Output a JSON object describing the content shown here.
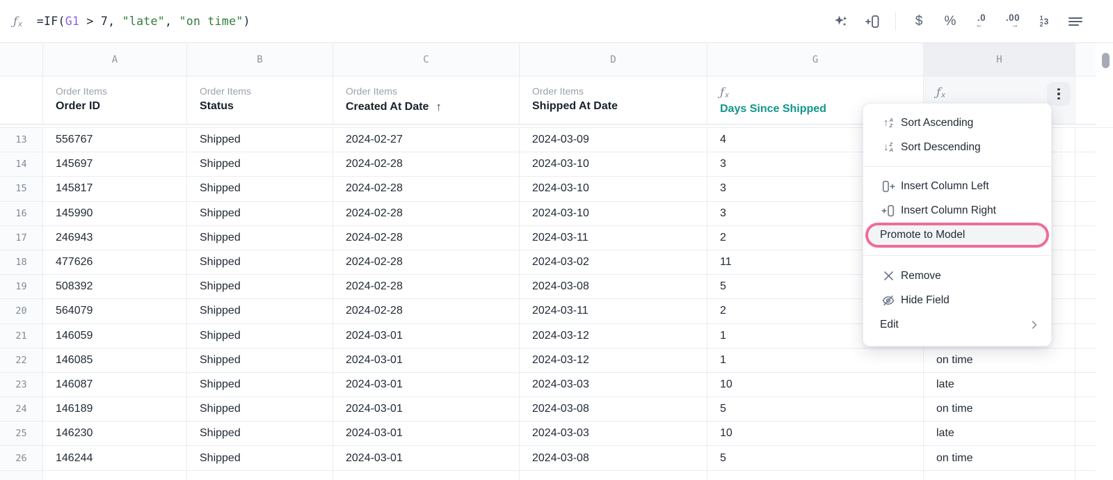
{
  "formula_bar": {
    "formula_tokens": [
      {
        "text": "=IF(",
        "style": "plain"
      },
      {
        "text": "G1",
        "style": "ref"
      },
      {
        "text": " > 7, ",
        "style": "plain"
      },
      {
        "text": "\"late\"",
        "style": "string"
      },
      {
        "text": ", ",
        "style": "plain"
      },
      {
        "text": "\"on time\"",
        "style": "string"
      },
      {
        "text": ")",
        "style": "plain"
      }
    ],
    "toolbar_icons": [
      "ai-sparkles",
      "insert-column-right",
      "currency-format",
      "percent-format",
      "decrease-decimals",
      "increase-decimals",
      "number-format",
      "menu"
    ]
  },
  "icons": {
    "fx_f": "ƒ",
    "fx_x": "x",
    "arrow_up": "↑",
    "arrow_down": "↓",
    "letter_a": "A",
    "letter_z": "Z",
    "currency": "$",
    "percent": "%",
    "dec0": ".0",
    "dec00": ".00",
    "arrow_left": "←",
    "arrow_right": "→",
    "one": "1",
    "two": "2",
    "three": "3"
  },
  "grid": {
    "column_letters": [
      "A",
      "B",
      "C",
      "D",
      "G",
      "H"
    ],
    "headers": {
      "a_group": "Order Items",
      "a_name": "Order ID",
      "b_group": "Order Items",
      "b_name": "Status",
      "c_group": "Order Items",
      "c_name": "Created At Date",
      "c_sort_indicator": "↑",
      "d_group": "Order Items",
      "d_name": "Shipped At Date",
      "g_name": "Days Since Shipped"
    },
    "rows": [
      {
        "num": "13",
        "order_id": "556767",
        "status": "Shipped",
        "created_at": "2024-02-27",
        "shipped_at": "2024-03-09",
        "days": "4",
        "result": ""
      },
      {
        "num": "14",
        "order_id": "145697",
        "status": "Shipped",
        "created_at": "2024-02-28",
        "shipped_at": "2024-03-10",
        "days": "3",
        "result": ""
      },
      {
        "num": "15",
        "order_id": "145817",
        "status": "Shipped",
        "created_at": "2024-02-28",
        "shipped_at": "2024-03-10",
        "days": "3",
        "result": ""
      },
      {
        "num": "16",
        "order_id": "145990",
        "status": "Shipped",
        "created_at": "2024-02-28",
        "shipped_at": "2024-03-10",
        "days": "3",
        "result": ""
      },
      {
        "num": "17",
        "order_id": "246943",
        "status": "Shipped",
        "created_at": "2024-02-28",
        "shipped_at": "2024-03-11",
        "days": "2",
        "result": ""
      },
      {
        "num": "18",
        "order_id": "477626",
        "status": "Shipped",
        "created_at": "2024-02-28",
        "shipped_at": "2024-03-02",
        "days": "11",
        "result": ""
      },
      {
        "num": "19",
        "order_id": "508392",
        "status": "Shipped",
        "created_at": "2024-02-28",
        "shipped_at": "2024-03-08",
        "days": "5",
        "result": ""
      },
      {
        "num": "20",
        "order_id": "564079",
        "status": "Shipped",
        "created_at": "2024-02-28",
        "shipped_at": "2024-03-11",
        "days": "2",
        "result": ""
      },
      {
        "num": "21",
        "order_id": "146059",
        "status": "Shipped",
        "created_at": "2024-03-01",
        "shipped_at": "2024-03-12",
        "days": "1",
        "result": ""
      },
      {
        "num": "22",
        "order_id": "146085",
        "status": "Shipped",
        "created_at": "2024-03-01",
        "shipped_at": "2024-03-12",
        "days": "1",
        "result": "on time"
      },
      {
        "num": "23",
        "order_id": "146087",
        "status": "Shipped",
        "created_at": "2024-03-01",
        "shipped_at": "2024-03-03",
        "days": "10",
        "result": "late"
      },
      {
        "num": "24",
        "order_id": "146189",
        "status": "Shipped",
        "created_at": "2024-03-01",
        "shipped_at": "2024-03-08",
        "days": "5",
        "result": "on time"
      },
      {
        "num": "25",
        "order_id": "146230",
        "status": "Shipped",
        "created_at": "2024-03-01",
        "shipped_at": "2024-03-03",
        "days": "10",
        "result": "late"
      },
      {
        "num": "26",
        "order_id": "146244",
        "status": "Shipped",
        "created_at": "2024-03-01",
        "shipped_at": "2024-03-08",
        "days": "5",
        "result": "on time"
      }
    ]
  },
  "context_menu": {
    "items": [
      {
        "icon": "sort-ascending-icon",
        "label": "Sort Ascending"
      },
      {
        "icon": "sort-descending-icon",
        "label": "Sort Descending"
      },
      {
        "icon": "insert-column-left-icon",
        "label": "Insert Column Left"
      },
      {
        "icon": "insert-column-right-icon",
        "label": "Insert Column Right"
      },
      {
        "icon": "",
        "label": "Promote to Model",
        "highlighted": true
      },
      {
        "icon": "remove-icon",
        "label": "Remove"
      },
      {
        "icon": "eye-off-icon",
        "label": "Hide Field"
      },
      {
        "icon": "",
        "label": "Edit",
        "submenu": true
      }
    ]
  },
  "colors": {
    "accent_teal": "#10968a",
    "token_reference_purple": "#8a63e8",
    "token_string_green": "#2e7d3a",
    "highlight_ring_pink": "#ed6d99",
    "grid_border": "#e9edf1",
    "header_text_gray": "#99a2ae",
    "icon_slate": "#566175",
    "selected_column_bg": "#edeff2"
  }
}
